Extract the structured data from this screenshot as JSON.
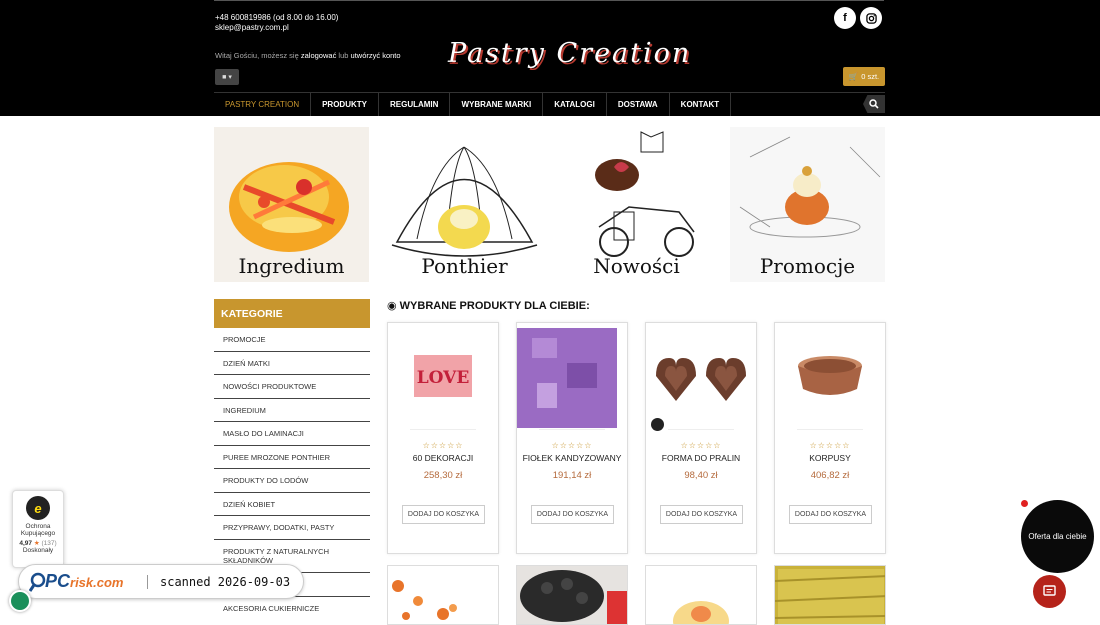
{
  "header": {
    "phone": "+48 600819986 (od 8.00 do 16.00)",
    "email": "sklep@pastry.com.pl",
    "greeting_prefix": "Witaj Gościu, możesz się",
    "login_link": "zalogować",
    "greeting_mid": "lub",
    "register_link": "utwórzyć konto",
    "logo_text": "Pastry Creation",
    "cart_label": "0 szt.",
    "social": [
      "facebook-icon",
      "instagram-icon"
    ]
  },
  "nav": {
    "items": [
      "PASTRY CREATION",
      "PRODUKTY",
      "REGULAMIN",
      "WYBRANE MARKI",
      "KATALOGI",
      "DOSTAWA",
      "KONTAKT"
    ]
  },
  "banners": [
    "Ingredium",
    "Ponthier",
    "Nowości",
    "Promocje"
  ],
  "sidebar": {
    "title": "KATEGORIE",
    "items": [
      "PROMOCJE",
      "DZIEŃ MATKI",
      "NOWOŚCI PRODUKTOWE",
      "INGREDIUM",
      "MASŁO DO LAMINACJI",
      "PUREE MROZONE PONTHIER",
      "PRODUKTY DO LODÓW",
      "DZIEŃ KOBIET",
      "PRZYPRAWY, DODATKI, PASTY",
      "PRODUKTY Z NATURALNYCH SKŁADNIKÓW",
      "",
      "AKCESORIA CUKIERNICZE"
    ]
  },
  "main": {
    "section_title": "WYBRANE PRODUKTY DLA CIEBIE:",
    "stars": "☆☆☆☆☆",
    "add_to_cart": "DODAJ DO KOSZYKA",
    "products": [
      {
        "name": "60 DEKORACJI",
        "price": "258,30 zł"
      },
      {
        "name": "FIOŁEK KANDYZOWANY",
        "price": "191,14 zł"
      },
      {
        "name": "FORMA DO PRALIN",
        "price": "98,40 zł"
      },
      {
        "name": "KORPUSY",
        "price": "406,82 zł"
      }
    ]
  },
  "trust": {
    "line1": "Ochrona",
    "line2": "Kupującego",
    "rating": "4,97",
    "count": "(137)",
    "label": "Doskonały"
  },
  "pcrisk": {
    "brand": "PC",
    "brand_suffix": "risk.com",
    "scan_text": "scanned 2026-09-03"
  },
  "offer": {
    "label": "Oferta dla ciebie"
  },
  "colors": {
    "accent": "#c8962e",
    "header_bg": "#000000",
    "price": "#b56b3d",
    "chat": "#b5231a"
  }
}
